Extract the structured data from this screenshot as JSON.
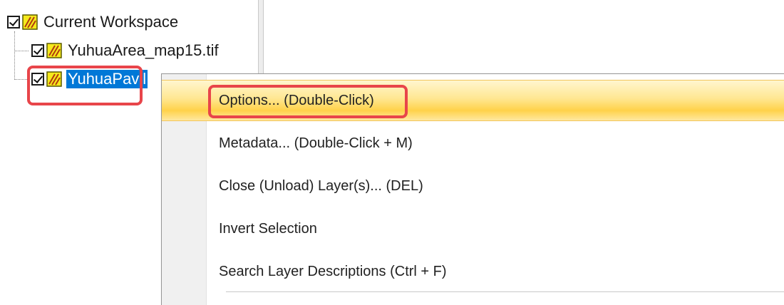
{
  "tree": {
    "root": {
      "label": "Current Workspace",
      "checked": true,
      "icon": "raster-layer-icon"
    },
    "layers": [
      {
        "label": "YuhuaArea_map15.tif",
        "checked": true,
        "icon": "raster-layer-icon"
      },
      {
        "label": "YuhuaPavil",
        "checked": true,
        "icon": "raster-layer-icon",
        "selected": true
      }
    ]
  },
  "context_menu": {
    "items": [
      {
        "label": "Options... (Double-Click)",
        "hovered": true
      },
      {
        "label": "Metadata... (Double-Click + M)"
      },
      {
        "label": "Close (Unload) Layer(s)... (DEL)"
      },
      {
        "label": "Invert Selection"
      },
      {
        "label": "Search Layer Descriptions (Ctrl + F)"
      }
    ]
  },
  "colors": {
    "annotation": "#e8454a",
    "selection": "#0078d7",
    "menu_hover": "#ffd24a"
  }
}
